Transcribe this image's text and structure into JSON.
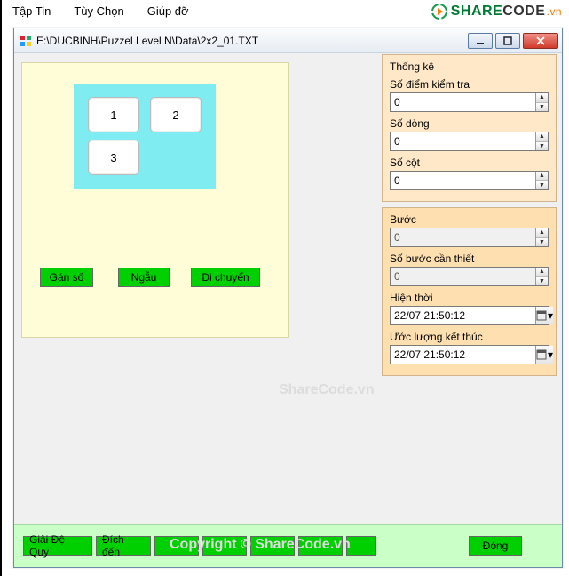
{
  "menu": {
    "file": "Tập Tin",
    "options": "Tùy Chọn",
    "help": "Giúp đỡ"
  },
  "brand": {
    "share": "SHARE",
    "code": "CODE",
    "vn": ".vn"
  },
  "window": {
    "title": "E:\\DUCBINH\\Puzzel Level N\\Data\\2x2_01.TXT"
  },
  "puzzle": {
    "tiles": [
      "1",
      "2",
      "3"
    ]
  },
  "left_buttons": {
    "assign": "Gán số",
    "random": "Ngẫu",
    "move": "Di chuyển"
  },
  "stats": {
    "heading": "Thống kê",
    "test_points_label": "Số điểm kiểm tra",
    "test_points": "0",
    "rows_label": "Số dòng",
    "rows": "0",
    "cols_label": "Số cột",
    "cols": "0",
    "step_label": "Bước",
    "step": "0",
    "needed_label": "Số bước cần thiết",
    "needed": "0",
    "now_label": "Hiện thời",
    "now": "22/07 21:50:12",
    "eta_label": "Ước lượng kết thúc",
    "eta": "22/07 21:50:12"
  },
  "bottom": {
    "recurse": "Giải Đệ Quy",
    "dest": "Đích đến",
    "close": "Đóng"
  },
  "watermark": {
    "center": "ShareCode.vn",
    "bottom": "Copyright © ShareCode.vn"
  }
}
